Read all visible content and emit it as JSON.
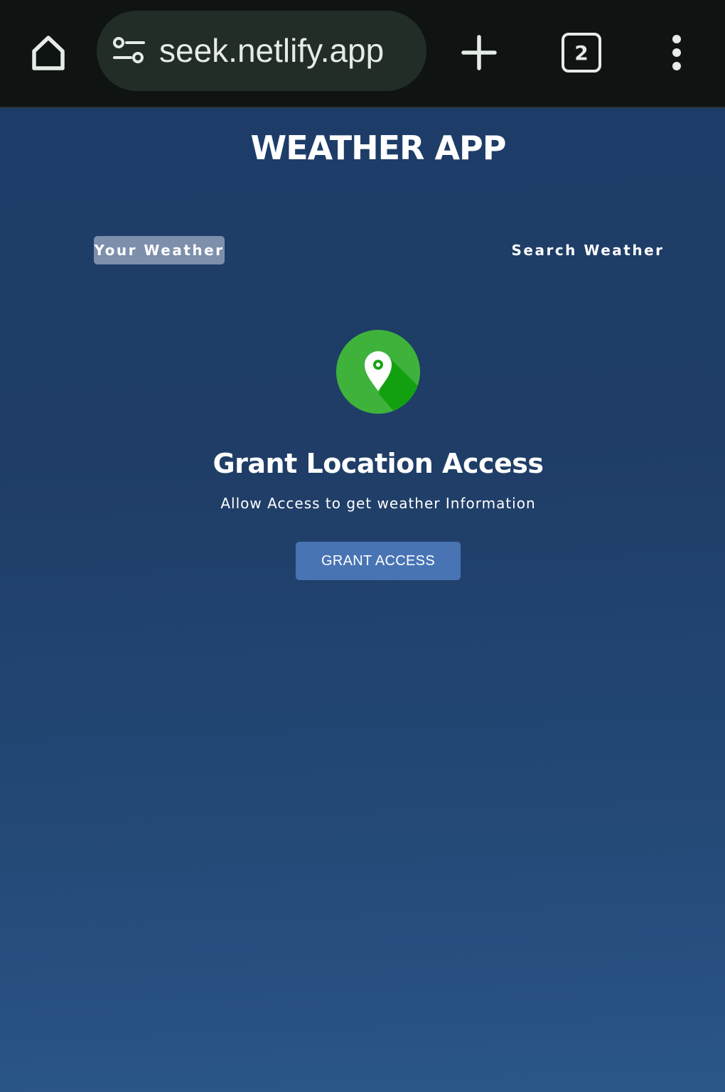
{
  "browser": {
    "url": "seek.netlify.app",
    "tab_count": "2",
    "icons": {
      "home": "home-icon",
      "site_info": "tune-icon",
      "new_tab": "plus-icon",
      "tabs": "tab-switcher-icon",
      "menu": "more-vertical-icon"
    }
  },
  "app": {
    "title": "WEATHER APP",
    "tabs": [
      {
        "label": "Your Weather",
        "active": true
      },
      {
        "label": "Search Weather",
        "active": false
      }
    ],
    "grant": {
      "icon": "location-pin-icon",
      "title": "Grant Location Access",
      "subtitle": "Allow Access to get weather Information",
      "button_label": "GRANT ACCESS"
    }
  },
  "colors": {
    "chrome_bg": "#0f1412",
    "url_bar_bg": "#232d27",
    "page_bg_top": "#1d3d68",
    "page_bg_bottom": "#2a5688",
    "active_tab_bg": "#a6b2c6",
    "button_bg": "#4874b4",
    "icon_green": "#3fb23c",
    "icon_green_dark": "#13a010"
  }
}
